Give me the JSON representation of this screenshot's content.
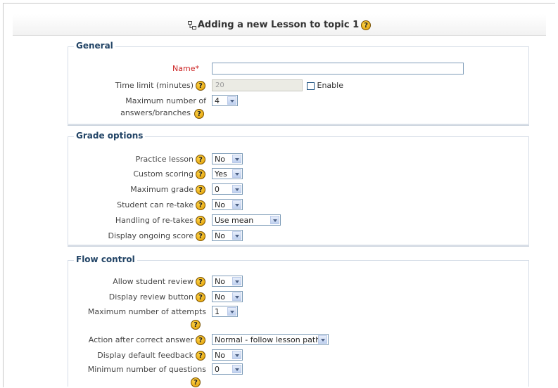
{
  "header": {
    "title": "Adding a new Lesson to topic 1",
    "help_glyph": "?"
  },
  "general": {
    "legend": "General",
    "name_label": "Name*",
    "name_value": "",
    "time_limit_label": "Time limit (minutes)",
    "time_limit_value": "20",
    "enable_label": "Enable",
    "max_answers_label_line1": "Maximum number of",
    "max_answers_label_line2": "answers/branches",
    "max_answers_value": "4"
  },
  "grade_options": {
    "legend": "Grade options",
    "practice_label": "Practice lesson",
    "practice_value": "No",
    "custom_scoring_label": "Custom scoring",
    "custom_scoring_value": "Yes",
    "max_grade_label": "Maximum grade",
    "max_grade_value": "0",
    "retake_label": "Student can re-take",
    "retake_value": "No",
    "handling_label": "Handling of re-takes",
    "handling_value": "Use mean",
    "ongoing_label": "Display ongoing score",
    "ongoing_value": "No"
  },
  "flow_control": {
    "legend": "Flow control",
    "review_label": "Allow student review",
    "review_value": "No",
    "review_button_label": "Display review button",
    "review_button_value": "No",
    "max_attempts_label": "Maximum number of attempts",
    "max_attempts_value": "1",
    "action_label": "Action after correct answer",
    "action_value": "Normal - follow lesson path",
    "default_feedback_label": "Display default feedback",
    "default_feedback_value": "No",
    "min_questions_label": "Minimum number of questions",
    "min_questions_value": "0"
  },
  "colors": {
    "legend_text": "#224466",
    "required_label": "#cc2222",
    "help_icon": "#f0b400"
  }
}
